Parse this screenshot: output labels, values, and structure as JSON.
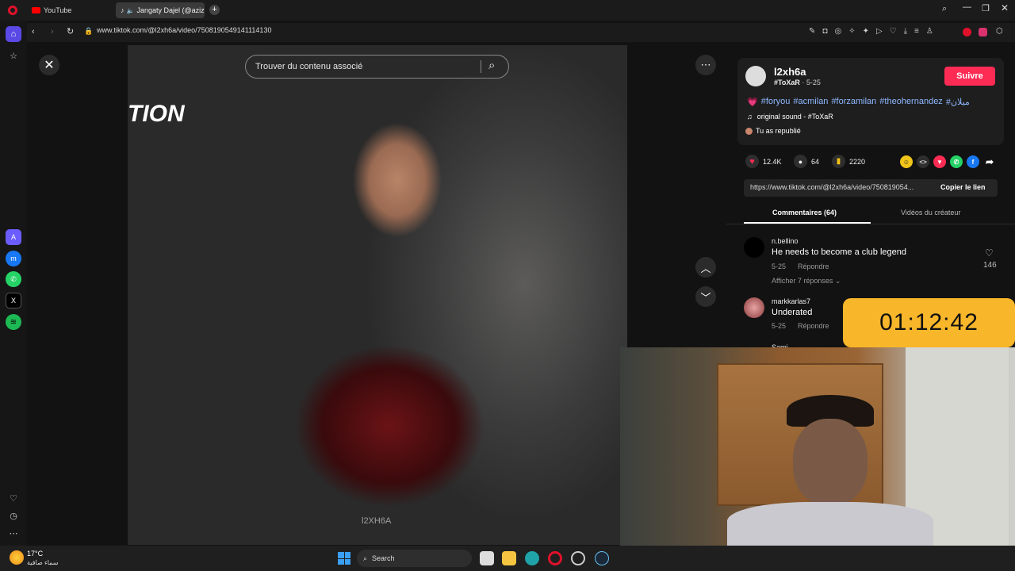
{
  "browser": {
    "tabs": [
      {
        "label": "YouTube",
        "icon": "youtube-icon"
      },
      {
        "label": "Jangaty Dajel (@azizg",
        "icon": "tiktok-icon"
      }
    ],
    "url": "www.tiktok.com/@l2xh6a/video/7508190549141114130"
  },
  "video": {
    "search_placeholder": "Trouver du contenu associé",
    "watermark": "l2XH6A",
    "overlay_text": "TION"
  },
  "post": {
    "username": "l2xh6a",
    "nickname": "#ToXaR",
    "date": "5-25",
    "follow_label": "Suivre",
    "caption_tags": [
      "#foryou",
      "#acmilan",
      "#forzamilan",
      "#theohernandez",
      "#ميلان"
    ],
    "sound": "original sound - #ToXaR",
    "reposted": "Tu as republié",
    "likes": "12.4K",
    "comments": "64",
    "saves": "2220",
    "link": "https://www.tiktok.com/@l2xh6a/video/750819054...",
    "copy_label": "Copier le lien"
  },
  "tabs": {
    "comments": "Commentaires (64)",
    "creator_videos": "Vidéos du créateur"
  },
  "comments": [
    {
      "name": "n.bellino",
      "text": "He needs to become a club legend",
      "date": "5-25",
      "reply": "Répondre",
      "likes": "146",
      "replies": "Afficher 7 réponses"
    },
    {
      "name": "markkarlas7",
      "text": "Underated",
      "date": "5-25",
      "reply": "Répondre"
    },
    {
      "name": "Sami"
    }
  ],
  "timer": "01:12:42",
  "taskbar": {
    "weather_temp": "17°C",
    "weather_desc": "سماء صافية",
    "search_label": "Search"
  },
  "colors": {
    "accent": "#fe2c55",
    "timer_bg": "#f8b62a",
    "hashtag": "#8fb8ff"
  }
}
